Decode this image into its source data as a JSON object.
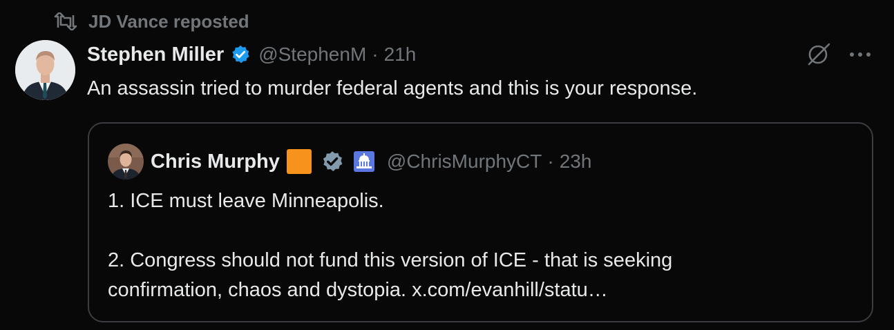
{
  "repost": {
    "icon": "repost-icon",
    "label": "JD Vance reposted"
  },
  "tweet": {
    "author": {
      "name": "Stephen Miller",
      "handle": "@StephenM",
      "verified_color": "#1d9bf0",
      "avatar": "avatar"
    },
    "separator": "·",
    "time": "21h",
    "text": "An assassin tried to murder federal agents and this is your response.",
    "actions": {
      "grok_icon": "grok-icon",
      "more_icon": "more-icon"
    }
  },
  "quote": {
    "author": {
      "name": "Chris Murphy",
      "handle": "@ChrisMurphyCT",
      "verified_color": "#829aab",
      "orange_badge_color": "#f7931a",
      "affiliation_icon": "capitol-icon"
    },
    "separator": "·",
    "time": "23h",
    "lines": [
      "1. ICE must leave Minneapolis.",
      "2. Congress should not fund this version of ICE - that is seeking",
      "confirmation, chaos and dystopia. x.com/evanhill/statu…"
    ]
  }
}
